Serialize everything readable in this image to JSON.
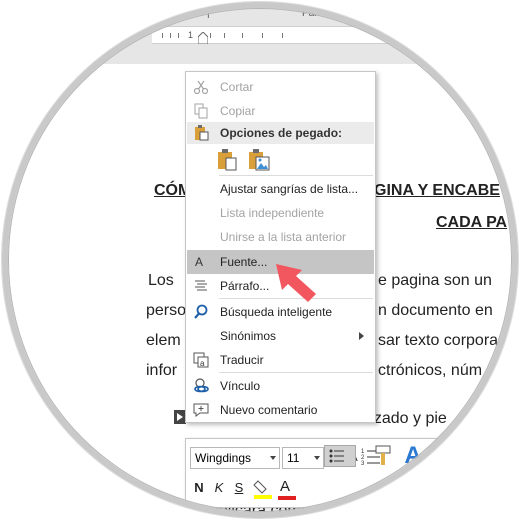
{
  "ruler": {
    "top_fragment_left": "|",
    "top_fragment_right": "Párr",
    "number": "1"
  },
  "document": {
    "title_line1_left": "CÓM",
    "title_line1_right": "GINA Y ENCABE",
    "title_line2": "CADA PA",
    "line1_left": "Los",
    "line1_right": "e pagina son un",
    "line2_left": "perso",
    "line2_right": "n documento en",
    "line3_left": "elem",
    "line3_right": "sar texto corpora",
    "line4_left": "infor",
    "line4_right": "ctrónicos, núm",
    "line5": "Normalmente el encabezado y pie",
    "line6": "explicara como"
  },
  "context_menu": {
    "cut": "Cortar",
    "copy": "Copiar",
    "paste_options": "Opciones de pegado:",
    "adjust_indents": "Ajustar sangrías de lista...",
    "independent_list": "Lista independiente",
    "join_previous": "Unirse a la lista anterior",
    "font": "Fuente...",
    "paragraph": "Párrafo...",
    "smart_lookup": "Búsqueda inteligente",
    "synonyms": "Sinónimos",
    "translate": "Traducir",
    "link": "Vínculo",
    "new_comment": "Nuevo comentario"
  },
  "mini_toolbar": {
    "font_name": "Wingdings",
    "font_size": "11",
    "grow_font": "A",
    "shrink_font": "A",
    "bold": "N",
    "italic": "K",
    "underline": "S",
    "font_color": "A",
    "styles": "A"
  },
  "colors": {
    "highlight": "#c5c5c5",
    "arrow": "#f2565f",
    "paste_icon": "#d9a03a",
    "link_icon": "#1f5fa8"
  }
}
